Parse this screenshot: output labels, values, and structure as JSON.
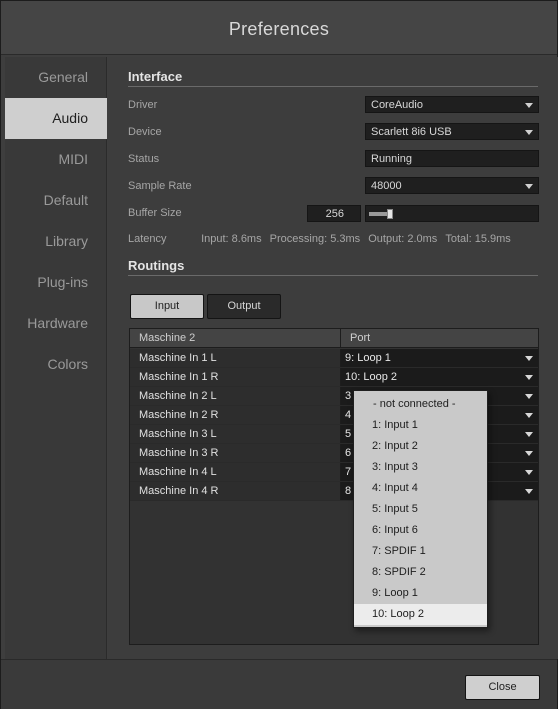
{
  "window": {
    "title": "Preferences"
  },
  "sidebar": {
    "items": [
      {
        "label": "General",
        "active": false
      },
      {
        "label": "Audio",
        "active": true
      },
      {
        "label": "MIDI",
        "active": false
      },
      {
        "label": "Default",
        "active": false
      },
      {
        "label": "Library",
        "active": false
      },
      {
        "label": "Plug-ins",
        "active": false
      },
      {
        "label": "Hardware",
        "active": false
      },
      {
        "label": "Colors",
        "active": false
      }
    ]
  },
  "interface": {
    "section_title": "Interface",
    "driver": {
      "label": "Driver",
      "value": "CoreAudio"
    },
    "device": {
      "label": "Device",
      "value": "Scarlett 8i6 USB"
    },
    "status": {
      "label": "Status",
      "value": "Running"
    },
    "sample_rate": {
      "label": "Sample Rate",
      "value": "48000"
    },
    "buffer_size": {
      "label": "Buffer Size",
      "value": "256",
      "slider_fraction": 0.12
    },
    "latency": {
      "label": "Latency",
      "input": "Input: 8.6ms",
      "processing": "Processing: 5.3ms",
      "output": "Output: 2.0ms",
      "total": "Total: 15.9ms"
    }
  },
  "routings": {
    "section_title": "Routings",
    "tabs": [
      {
        "label": "Input",
        "active": true
      },
      {
        "label": "Output",
        "active": false
      }
    ],
    "columns": [
      "Maschine 2",
      "Port"
    ],
    "rows": [
      {
        "name": "Maschine In 1 L",
        "port": "9: Loop 1"
      },
      {
        "name": "Maschine In 1 R",
        "port": "10: Loop 2"
      },
      {
        "name": "Maschine In 2 L",
        "port": "3"
      },
      {
        "name": "Maschine In 2 R",
        "port": "4"
      },
      {
        "name": "Maschine In 3 L",
        "port": "5"
      },
      {
        "name": "Maschine In 3 R",
        "port": "6"
      },
      {
        "name": "Maschine In 4 L",
        "port": "7"
      },
      {
        "name": "Maschine In 4 R",
        "port": "8"
      }
    ]
  },
  "port_dropdown": {
    "selected": "10: Loop 2",
    "options": [
      "- not connected -",
      "1: Input 1",
      "2: Input 2",
      "3: Input 3",
      "4: Input 4",
      "5: Input 5",
      "6: Input 6",
      "7: SPDIF 1",
      "8: SPDIF 2",
      "9: Loop 1",
      "10: Loop 2"
    ]
  },
  "footer": {
    "close_label": "Close"
  }
}
